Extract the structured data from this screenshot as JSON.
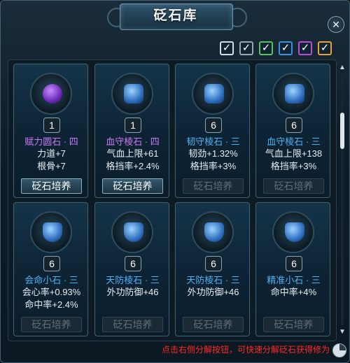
{
  "window": {
    "title": "砭石库",
    "close_glyph": "✕"
  },
  "filters": [
    {
      "name": "filter-white",
      "color": "#d6dde2",
      "glyph": "✓"
    },
    {
      "name": "filter-gray",
      "color": "#9aa7b0",
      "glyph": "✓"
    },
    {
      "name": "filter-green",
      "color": "#58c25a",
      "glyph": "✓"
    },
    {
      "name": "filter-blue",
      "color": "#3f8fe0",
      "glyph": "✓"
    },
    {
      "name": "filter-purple",
      "color": "#c04ad8",
      "glyph": "✓"
    },
    {
      "name": "filter-orange",
      "color": "#e7a23a",
      "glyph": "✓"
    }
  ],
  "cards": [
    {
      "icon": "purple-round-gem-icon",
      "level": "1",
      "name": "赋力圆石 · 四",
      "name_color": "#c77bf2",
      "stats": [
        "力道+7",
        "根骨+7"
      ],
      "button": "砭石培养",
      "enabled": true
    },
    {
      "icon": "blue-square-gem-icon",
      "level": "1",
      "name": "血守棱石 · 四",
      "name_color": "#c77bf2",
      "stats": [
        "气血上限+61",
        "格挡率+2.4%"
      ],
      "button": "砭石培养",
      "enabled": true
    },
    {
      "icon": "blue-square-gem-icon",
      "level": "6",
      "name": "韧守棱石 · 三",
      "name_color": "#4fb2f2",
      "stats": [
        "韧劲+1.32%",
        "格挡率+3%"
      ],
      "button": "砭石培养",
      "enabled": false
    },
    {
      "icon": "blue-square-gem-icon",
      "level": "6",
      "name": "血守棱石 · 三",
      "name_color": "#4fb2f2",
      "stats": [
        "气血上限+138",
        "格挡率+3%"
      ],
      "button": "砭石培养",
      "enabled": false
    },
    {
      "icon": "blue-shield-gem-icon",
      "level": "6",
      "name": "会命小石 · 三",
      "name_color": "#4fb2f2",
      "stats": [
        "会心率+0.93%",
        "命中率+2.4%"
      ],
      "button": "砭石培养",
      "enabled": false
    },
    {
      "icon": "blue-shield-gem-icon",
      "level": "6",
      "name": "天防棱石 · 三",
      "name_color": "#4fb2f2",
      "stats": [
        "外功防御+46"
      ],
      "button": "砭石培养",
      "enabled": false
    },
    {
      "icon": "blue-shield-gem-icon",
      "level": "6",
      "name": "天防棱石 · 三",
      "name_color": "#4fb2f2",
      "stats": [
        "外功防御+46"
      ],
      "button": "砭石培养",
      "enabled": false
    },
    {
      "icon": "blue-shield-gem-icon",
      "level": "6",
      "name": "精准小石 · 三",
      "name_color": "#4fb2f2",
      "stats": [
        "命中率+4%"
      ],
      "button": "砭石培养",
      "enabled": false
    }
  ],
  "footer": {
    "hint": "点击右侧分解按钮，可快速分解砭石获得修为"
  }
}
